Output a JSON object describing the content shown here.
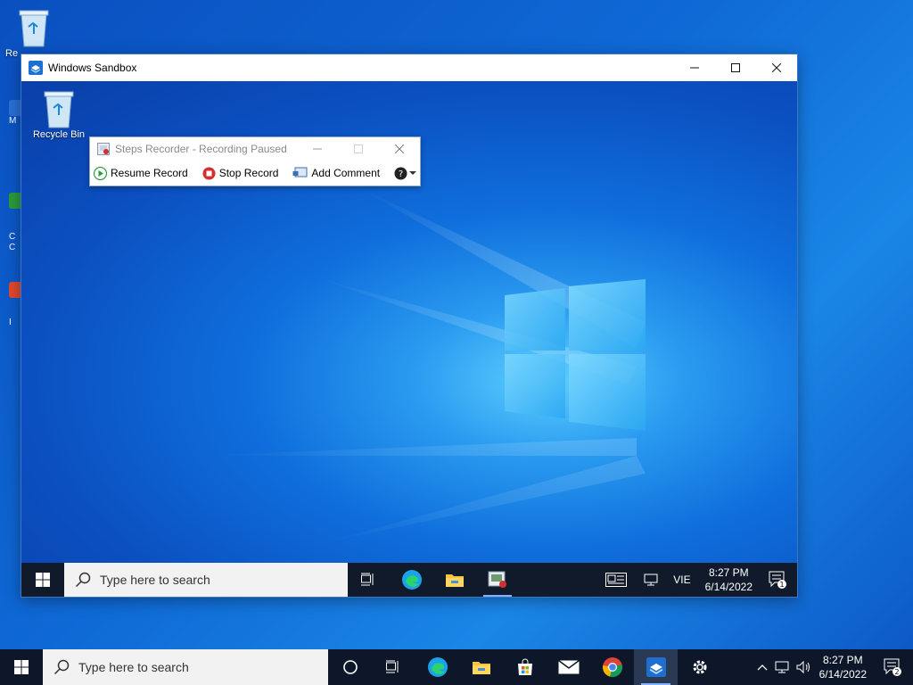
{
  "host_desktop": {
    "recycle_bin_label": "Re",
    "side_labels": [
      "M",
      "C",
      "C",
      "I"
    ]
  },
  "sandbox_window": {
    "title": "Windows Sandbox",
    "buttons": {
      "minimize": "—",
      "maximize": "☐",
      "close": "✕"
    },
    "desktop": {
      "recycle_bin_label": "Recycle Bin"
    },
    "steps_recorder": {
      "title": "Steps Recorder - Recording Paused",
      "resume_label": "Resume Record",
      "stop_label": "Stop Record",
      "comment_label": "Add Comment"
    },
    "taskbar": {
      "search_placeholder": "Type here to search",
      "lang": "VIE",
      "time": "8:27 PM",
      "date": "6/14/2022",
      "notification_count": "1"
    }
  },
  "host_taskbar": {
    "search_placeholder": "Type here to search",
    "time": "8:27 PM",
    "date": "6/14/2022",
    "notification_count": "2"
  },
  "colors": {
    "accent": "#0078d7",
    "taskbar": "#101a2a",
    "stop_red": "#d32f2f",
    "resume_green": "#2e9a3b"
  }
}
